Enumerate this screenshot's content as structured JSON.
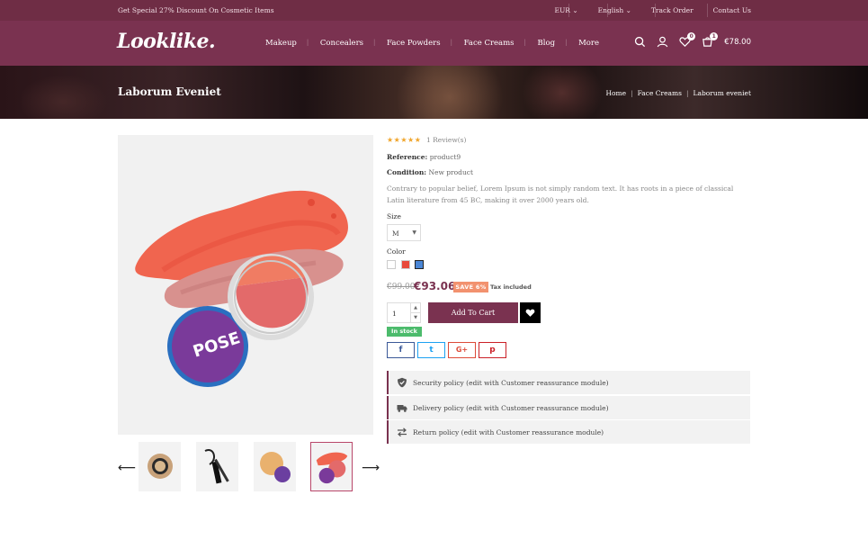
{
  "topbar": {
    "promo": "Get Special 27% Discount On Cosmetic Items",
    "currency": "EUR ⌄",
    "language": "English ⌄",
    "track_order": "Track Order",
    "contact": "Contact Us"
  },
  "header": {
    "logo": "Looklike.",
    "nav": [
      "Makeup",
      "Concealers",
      "Face Powders",
      "Face Creams",
      "Blog",
      "More"
    ],
    "wishlist_count": "0",
    "cart_count": "1",
    "cart_total": "€78.00",
    "icons": [
      "search-icon",
      "user-icon",
      "heart-icon",
      "cart-icon"
    ]
  },
  "banner": {
    "title": "Laborum Eveniet",
    "breadcrumb": [
      "Home",
      "Face Creams",
      "Laborum eveniet"
    ]
  },
  "product": {
    "stars": "★★★★★",
    "reviews": "1 Review(s)",
    "reference_label": "Reference:",
    "reference": "product9",
    "condition_label": "Condition:",
    "condition": "New product",
    "description": "Contrary to popular belief, Lorem Ipsum is not simply random text. It has roots in a piece of classical Latin literature from 45 BC, making it over 2000 years old.",
    "size_label": "Size",
    "size_value": "M",
    "color_label": "Color",
    "colors": [
      "#ffffff",
      "#e84a3b",
      "#4a86d6"
    ],
    "old_price": "€99.00",
    "price": "€93.06",
    "save_badge": "SAVE 6%",
    "tax": "Tax included",
    "quantity": "1",
    "add_to_cart": "Add To Cart",
    "stock": "In stock",
    "share": [
      "f",
      "t",
      "G+",
      "p"
    ],
    "share_icons": [
      "facebook-icon",
      "twitter-icon",
      "google-plus-icon",
      "pinterest-icon"
    ],
    "policies": [
      "Security policy (edit with Customer reassurance module)",
      "Delivery policy (edit with Customer reassurance module)",
      "Return policy (edit with Customer reassurance module)"
    ],
    "thumbnail_labels": [
      "compact-powder",
      "eyeliner",
      "loose-powder",
      "blush-pose"
    ],
    "thumb_text": "POSE"
  },
  "colors": {
    "brand": "#7a3250",
    "topbar": "#6f2d45",
    "star": "#f0a52b",
    "save": "#f2926f",
    "stock": "#4cbb6c",
    "facebook": "#3b5998",
    "twitter": "#1da1f2",
    "google": "#dd4b39",
    "pinterest": "#cb2027"
  }
}
